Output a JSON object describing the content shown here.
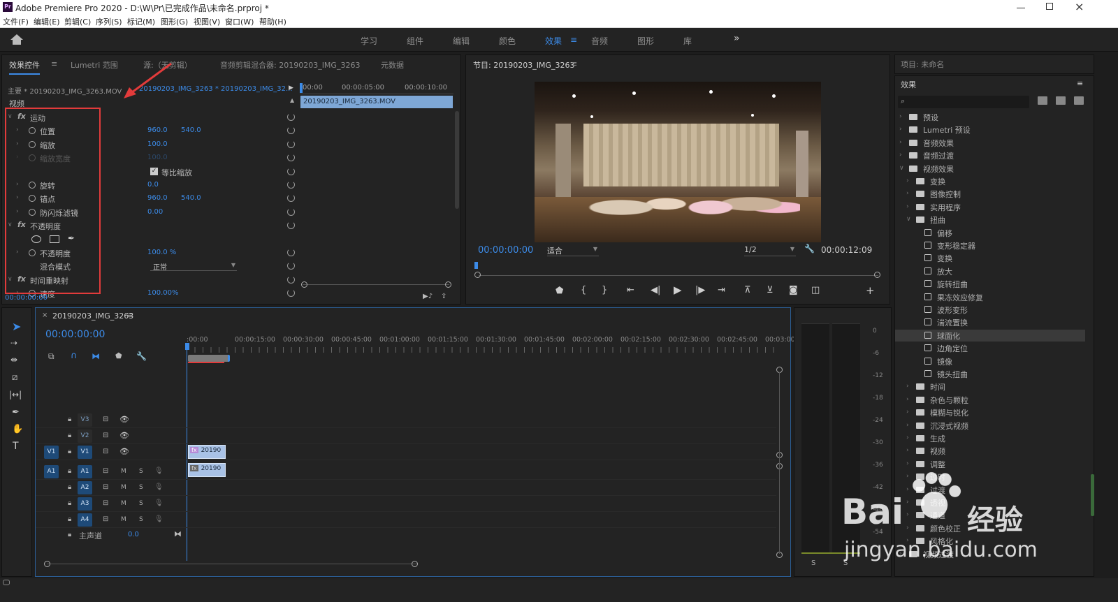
{
  "window": {
    "title": "Adobe Premiere Pro 2020 - D:\\W\\Pr\\已完成作品\\未命名.prproj *",
    "app_badge": "Pr"
  },
  "menus": [
    "文件(F)",
    "编辑(E)",
    "剪辑(C)",
    "序列(S)",
    "标记(M)",
    "图形(G)",
    "视图(V)",
    "窗口(W)",
    "帮助(H)"
  ],
  "workspaces": [
    "学习",
    "组件",
    "编辑",
    "颜色",
    "效果",
    "音频",
    "图形",
    "库"
  ],
  "active_workspace": "效果",
  "more_label": "»",
  "effect_controls": {
    "tabs": [
      "效果控件",
      "Lumetri 范围",
      "源:（无剪辑）",
      "音频剪辑混合器: 20190203_IMG_3263",
      "元数据"
    ],
    "master_label": "主要 * 20190203_IMG_3263.MOV",
    "clip_label": "20190203_IMG_3263 * 20190203_IMG_32...",
    "ruler": [
      "00:00",
      "00:00:05:00",
      "00:00:10:00"
    ],
    "clip_bar": "20190203_IMG_3263.MOV",
    "section_video": "视频",
    "rows": [
      {
        "kind": "group",
        "label": "运动",
        "fx": "fx"
      },
      {
        "kind": "prop",
        "label": "位置",
        "v1": "960.0",
        "v2": "540.0"
      },
      {
        "kind": "prop",
        "label": "缩放",
        "v1": "100.0",
        "v2": ""
      },
      {
        "kind": "prop",
        "label": "缩放宽度",
        "v1": "100.0",
        "v2": "",
        "dim": true
      },
      {
        "kind": "check",
        "label": "等比缩放"
      },
      {
        "kind": "prop",
        "label": "旋转",
        "v1": "0.0",
        "v2": ""
      },
      {
        "kind": "prop",
        "label": "锚点",
        "v1": "960.0",
        "v2": "540.0"
      },
      {
        "kind": "prop",
        "label": "防闪烁滤镜",
        "v1": "0.00",
        "v2": ""
      },
      {
        "kind": "group",
        "label": "不透明度",
        "fx": "fx"
      },
      {
        "kind": "shapes",
        "label": ""
      },
      {
        "kind": "prop",
        "label": "不透明度",
        "v1": "100.0 %",
        "v2": ""
      },
      {
        "kind": "select",
        "label": "混合模式",
        "v1": "正常",
        "v2": ""
      },
      {
        "kind": "group",
        "label": "时间重映射",
        "fx": "fx"
      },
      {
        "kind": "prop",
        "label": "速度",
        "v1": "100.00%",
        "v2": ""
      }
    ],
    "timecode": "00:00:00:00"
  },
  "program": {
    "title": "节目: 20190203_IMG_3263",
    "timecode": "00:00:00:00",
    "fit": "适合",
    "resolution": "1/2",
    "duration": "00:00:12:09"
  },
  "project": {
    "title": "项目: 未命名"
  },
  "effects": {
    "title": "效果",
    "tree": [
      {
        "level": 0,
        "type": "folder",
        "label": "预设",
        "open": false
      },
      {
        "level": 0,
        "type": "folder",
        "label": "Lumetri 预设",
        "open": false
      },
      {
        "level": 0,
        "type": "folder",
        "label": "音频效果",
        "open": false
      },
      {
        "level": 0,
        "type": "folder",
        "label": "音频过渡",
        "open": false
      },
      {
        "level": 0,
        "type": "folder",
        "label": "视频效果",
        "open": true
      },
      {
        "level": 1,
        "type": "folder",
        "label": "变换",
        "open": false
      },
      {
        "level": 1,
        "type": "folder",
        "label": "图像控制",
        "open": false
      },
      {
        "level": 1,
        "type": "folder",
        "label": "实用程序",
        "open": false
      },
      {
        "level": 1,
        "type": "folder",
        "label": "扭曲",
        "open": true
      },
      {
        "level": 2,
        "type": "fx",
        "label": "偏移"
      },
      {
        "level": 2,
        "type": "fx",
        "label": "变形稳定器"
      },
      {
        "level": 2,
        "type": "fx",
        "label": "变换"
      },
      {
        "level": 2,
        "type": "fx",
        "label": "放大"
      },
      {
        "level": 2,
        "type": "fx",
        "label": "旋转扭曲"
      },
      {
        "level": 2,
        "type": "fx",
        "label": "果冻效应修复"
      },
      {
        "level": 2,
        "type": "fx",
        "label": "波形变形"
      },
      {
        "level": 2,
        "type": "fx",
        "label": "湍流置换"
      },
      {
        "level": 2,
        "type": "fx",
        "label": "球面化",
        "selected": true
      },
      {
        "level": 2,
        "type": "fx",
        "label": "边角定位"
      },
      {
        "level": 2,
        "type": "fx",
        "label": "镜像"
      },
      {
        "level": 2,
        "type": "fx",
        "label": "镜头扭曲"
      },
      {
        "level": 1,
        "type": "folder",
        "label": "时间",
        "open": false
      },
      {
        "level": 1,
        "type": "folder",
        "label": "杂色与颗粒",
        "open": false
      },
      {
        "level": 1,
        "type": "folder",
        "label": "模糊与锐化",
        "open": false
      },
      {
        "level": 1,
        "type": "folder",
        "label": "沉浸式视频",
        "open": false
      },
      {
        "level": 1,
        "type": "folder",
        "label": "生成",
        "open": false
      },
      {
        "level": 1,
        "type": "folder",
        "label": "视频",
        "open": false
      },
      {
        "level": 1,
        "type": "folder",
        "label": "调整",
        "open": false
      },
      {
        "level": 1,
        "type": "folder",
        "label": "过时",
        "open": false
      },
      {
        "level": 1,
        "type": "folder",
        "label": "过渡",
        "open": false
      },
      {
        "level": 1,
        "type": "folder",
        "label": "透视",
        "open": false
      },
      {
        "level": 1,
        "type": "folder",
        "label": "通道",
        "open": false
      },
      {
        "level": 1,
        "type": "folder",
        "label": "颜色校正",
        "open": false
      },
      {
        "level": 1,
        "type": "folder",
        "label": "风格化",
        "open": false
      },
      {
        "level": 0,
        "type": "folder",
        "label": "视频过渡",
        "open": false
      }
    ]
  },
  "timeline": {
    "sequence": "20190203_IMG_3263",
    "timecode": "00:00:00:00",
    "ruler": [
      ":00:00",
      "00:00:15:00",
      "00:00:30:00",
      "00:00:45:00",
      "00:01:00:00",
      "00:01:15:00",
      "00:01:30:00",
      "00:01:45:00",
      "00:02:00:00",
      "00:02:15:00",
      "00:02:30:00",
      "00:02:45:00",
      "00:03:00"
    ],
    "video_tracks": [
      "V3",
      "V2",
      "V1"
    ],
    "audio_tracks": [
      "A1",
      "A2",
      "A3",
      "A4"
    ],
    "source_v": "V1",
    "source_a": "A1",
    "mix_label": "主声道",
    "mix_value": "0.0",
    "clip_label": "20190",
    "M": "M",
    "S": "S",
    "fx": "fx"
  },
  "meter": {
    "db": [
      "0",
      "-6",
      "-12",
      "-18",
      "-24",
      "-30",
      "-36",
      "-42",
      "-48",
      "-54"
    ],
    "solo": "S"
  },
  "watermark": {
    "brand": "Bai",
    "brand_accent": "经验",
    "url": "jingyan.baidu.com"
  },
  "colors": {
    "accent": "#3c8be8",
    "highlight": "#e23b3b",
    "clip_blue": "#7ea7d6",
    "active_tab": "#3c8be8"
  }
}
